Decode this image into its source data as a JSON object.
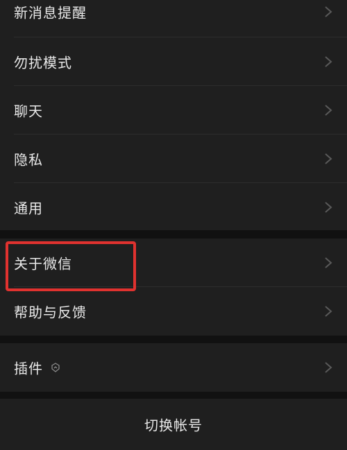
{
  "settings": {
    "items": [
      {
        "label": "新消息提醒"
      },
      {
        "label": "勿扰模式"
      },
      {
        "label": "聊天"
      },
      {
        "label": "隐私"
      },
      {
        "label": "通用"
      },
      {
        "label": "关于微信"
      },
      {
        "label": "帮助与反馈"
      },
      {
        "label": "插件"
      }
    ],
    "switch_account_label": "切换帐号"
  },
  "colors": {
    "page_background": "#111111",
    "row_background": "#1f1f1f",
    "text": "#e9e9e9",
    "chevron": "#5a5a5a",
    "highlight": "#e0322f"
  },
  "icons": {
    "row_arrow": "chevron-right-icon",
    "plugin_badge": "plugin-badge-icon"
  }
}
